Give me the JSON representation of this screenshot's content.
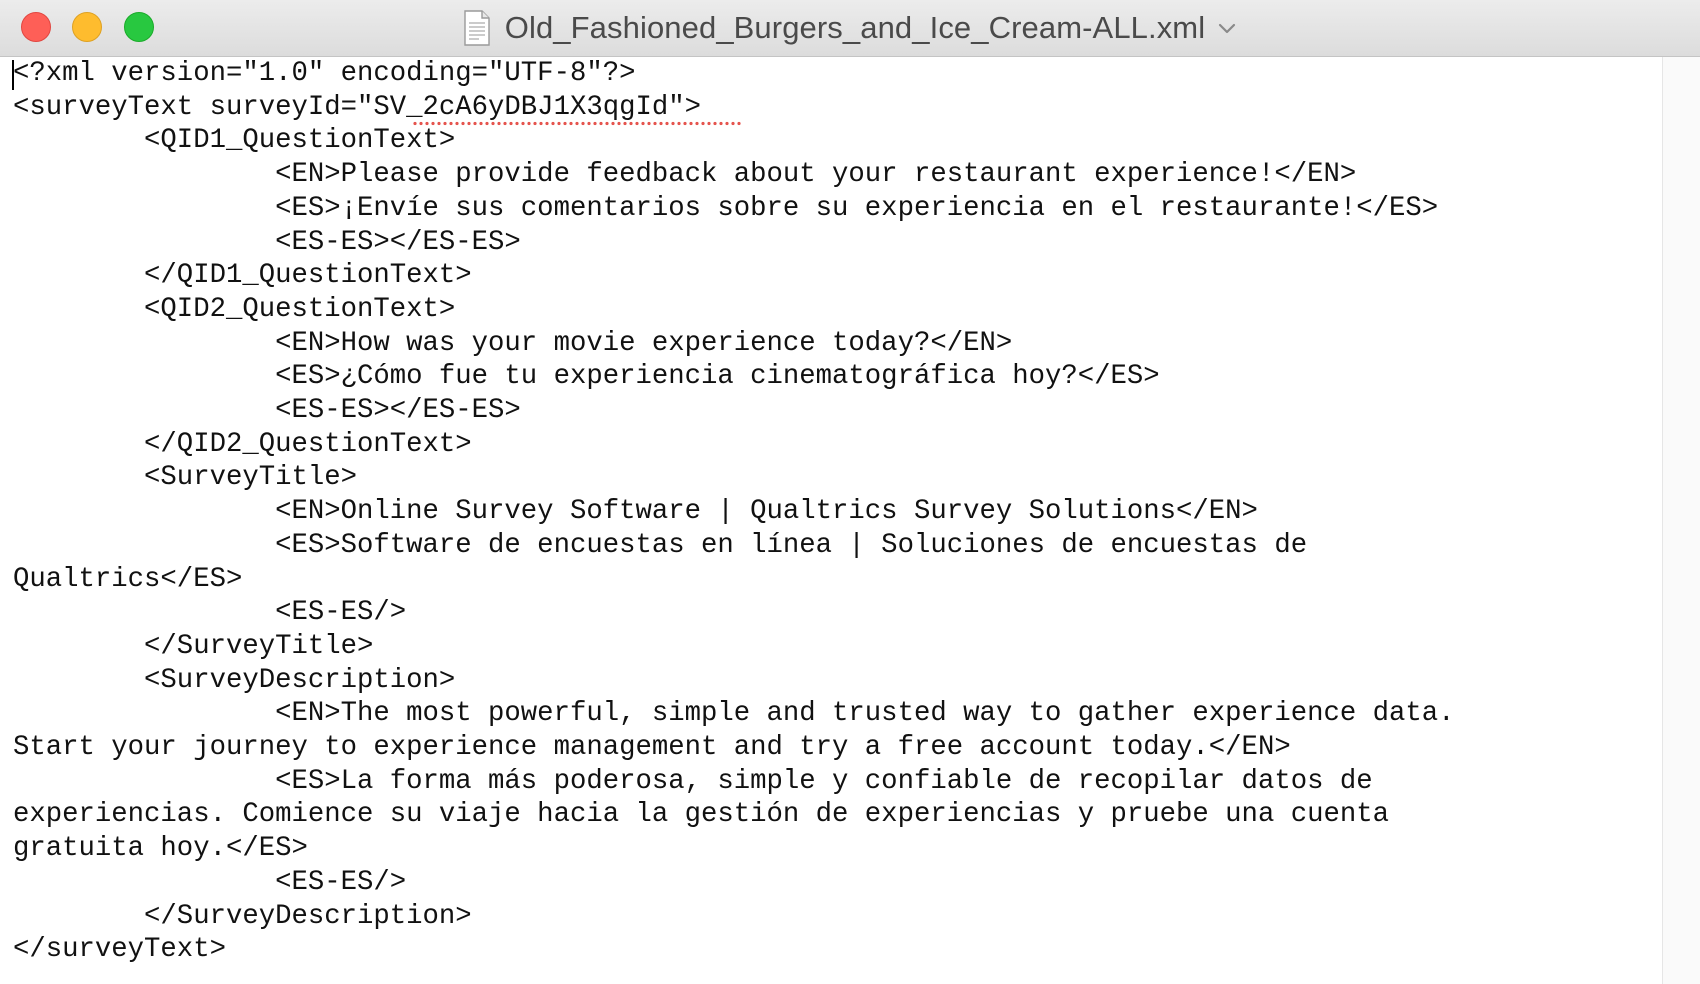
{
  "window": {
    "title": "Old_Fashioned_Burgers_and_Ice_Cream-ALL.xml",
    "icons": {
      "document": "document-icon",
      "chevron": "chevron-down-icon"
    },
    "colors": {
      "close": "#fe5f57",
      "minimize": "#febc2e",
      "zoom": "#28c840",
      "spellcheck_underline": "#e5554f"
    }
  },
  "document": {
    "lines": [
      "<?xml version=\"1.0\" encoding=\"UTF-8\"?>",
      "<surveyText surveyId=\"SV_2cA6yDBJ1X3qgId\">",
      "        <QID1_QuestionText>",
      "                <EN>Please provide feedback about your restaurant experience!</EN>",
      "                <ES>¡Envíe sus comentarios sobre su experiencia en el restaurante!</ES>",
      "                <ES-ES></ES-ES>",
      "        </QID1_QuestionText>",
      "        <QID2_QuestionText>",
      "                <EN>How was your movie experience today?</EN>",
      "                <ES>¿Cómo fue tu experiencia cinematográfica hoy?</ES>",
      "                <ES-ES></ES-ES>",
      "        </QID2_QuestionText>",
      "        <SurveyTitle>",
      "                <EN>Online Survey Software | Qualtrics Survey Solutions</EN>",
      "                <ES>Software de encuestas en línea | Soluciones de encuestas de",
      "Qualtrics</ES>",
      "                <ES-ES/>",
      "        </SurveyTitle>",
      "        <SurveyDescription>",
      "                <EN>The most powerful, simple and trusted way to gather experience data.",
      "Start your journey to experience management and try a free account today.</EN>",
      "                <ES>La forma más poderosa, simple y confiable de recopilar datos de",
      "experiencias. Comience su viaje hacia la gestión de experiencias y pruebe una cuenta",
      "gratuita hoy.</ES>",
      "                <ES-ES/>",
      "        </SurveyDescription>",
      "</surveyText>"
    ]
  }
}
